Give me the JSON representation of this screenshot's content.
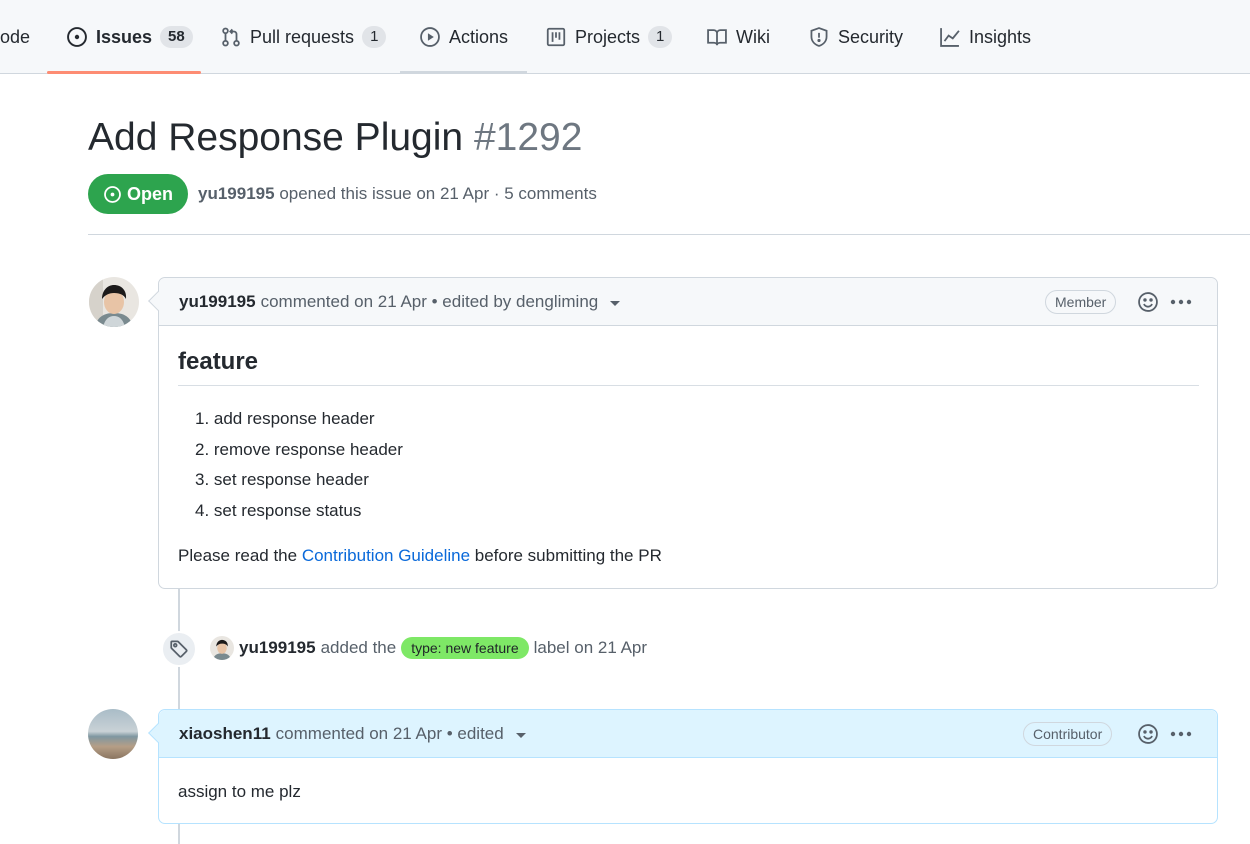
{
  "nav": {
    "tabs": [
      {
        "label": "ode",
        "icon": "code-icon"
      },
      {
        "label": "Issues",
        "count": "58",
        "icon": "issue-opened-icon"
      },
      {
        "label": "Pull requests",
        "count": "1",
        "icon": "git-pull-request-icon"
      },
      {
        "label": "Actions",
        "icon": "play-icon"
      },
      {
        "label": "Projects",
        "count": "1",
        "icon": "project-icon"
      },
      {
        "label": "Wiki",
        "icon": "book-icon"
      },
      {
        "label": "Security",
        "icon": "shield-icon"
      },
      {
        "label": "Insights",
        "icon": "graph-icon"
      }
    ],
    "selected": "Issues",
    "accent": "#fd8c73"
  },
  "issue": {
    "title": "Add Response Plugin",
    "number": "#1292",
    "state": "Open",
    "state_color": "#2da44e",
    "author": "yu199195",
    "meta_text": "opened this issue on 21 Apr · 5 comments"
  },
  "comments": [
    {
      "author": "yu199195",
      "header_text": "commented on 21 Apr • edited by dengliming",
      "role": "Member",
      "heading": "feature",
      "list": [
        "1. add response header",
        "2. remove response header",
        "3. set response header",
        "4. set response status"
      ],
      "para_before": "Please read the ",
      "link": "Contribution Guideline",
      "para_after": " before submitting the PR"
    },
    {
      "author": "xiaoshen11",
      "header_text": "commented on 21 Apr • edited",
      "role": "Contributor",
      "body": "assign to me plz"
    }
  ],
  "event": {
    "author": "yu199195",
    "before": "added the",
    "label": "type: new feature",
    "label_color": "#7ee866",
    "after": "label on 21 Apr"
  }
}
